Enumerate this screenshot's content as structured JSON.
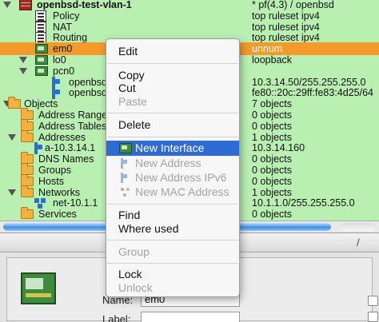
{
  "tree": {
    "rows": [
      {
        "name": "openbsd-test-vlan-1",
        "col2": "* pf(4.3) / openbsd"
      },
      {
        "name": "Policy",
        "col2": "top ruleset ipv4"
      },
      {
        "name": "NAT",
        "col2": "top ruleset ipv4"
      },
      {
        "name": "Routing",
        "col2": "top ruleset ipv4"
      },
      {
        "name": "em0",
        "col2": "unnum"
      },
      {
        "name": "lo0",
        "col2": "loopback"
      },
      {
        "name": "pcn0",
        "col2": ""
      },
      {
        "name": "openbsd",
        "col2": "10.3.14.50/255.255.255.0"
      },
      {
        "name": "openbsd",
        "col2": "fe80::20c:29ff:fe83:4d25/64"
      },
      {
        "name": "Objects",
        "col2": "7 objects"
      },
      {
        "name": "Address Ranges",
        "col2": "0 objects"
      },
      {
        "name": "Address Tables",
        "col2": "0 objects"
      },
      {
        "name": "Addresses",
        "col2": "1 objects"
      },
      {
        "name": "a-10.3.14.1",
        "col2": "10.3.14.160"
      },
      {
        "name": "DNS Names",
        "col2": "0 objects"
      },
      {
        "name": "Groups",
        "col2": "0 objects"
      },
      {
        "name": "Hosts",
        "col2": "0 objects"
      },
      {
        "name": "Networks",
        "col2": "1 objects"
      },
      {
        "name": "net-10.1.1",
        "col2": "10.1.1.0/255.255.255.0"
      },
      {
        "name": "Services",
        "col2": "0 objects"
      }
    ]
  },
  "menu": {
    "edit": "Edit",
    "copy": "Copy",
    "cut": "Cut",
    "paste": "Paste",
    "delete": "Delete",
    "new_interface": "New Interface",
    "new_address": "New Address",
    "new_address_ipv6": "New Address IPv6",
    "new_mac_address": "New MAC Address",
    "find": "Find",
    "where_used": "Where used",
    "group": "Group",
    "lock": "Lock",
    "unlock": "Unlock"
  },
  "editor": {
    "tab_sep": "/",
    "name_label": "Name:",
    "name_value": "em0",
    "label_label": "Label:"
  },
  "colors": {
    "tree_bg": "#b9f0b2",
    "selection": "#f39a2a",
    "menu_highlight": "#2f6bd4"
  }
}
